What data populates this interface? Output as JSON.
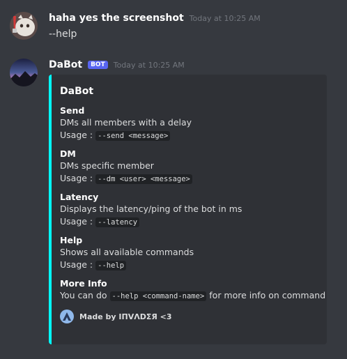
{
  "messages": [
    {
      "username": "haha yes the screenshot",
      "timestamp": "Today at 10:25 AM",
      "text": "--help"
    },
    {
      "username": "DaBot",
      "badge": "BOT",
      "timestamp": "Today at 10:25 AM"
    }
  ],
  "embed": {
    "accent_color": "#00ffff",
    "title": "DaBot",
    "fields": [
      {
        "name": "Send",
        "description": "DMs all members with a delay",
        "usage_label": "Usage :",
        "usage_code": "--send <message>"
      },
      {
        "name": "DM",
        "description": "DMs specific member",
        "usage_label": "Usage :",
        "usage_code": "--dm <user> <message>"
      },
      {
        "name": "Latency",
        "description": "Displays the latency/ping of the bot in ms",
        "usage_label": "Usage :",
        "usage_code": "--latency"
      },
      {
        "name": "Help",
        "description": "Shows all available commands",
        "usage_label": "Usage :",
        "usage_code": "--help"
      }
    ],
    "more_info": {
      "name": "More Info",
      "prefix": "You can do",
      "code": "--help <command-name>",
      "suffix": "for more info on command"
    },
    "footer": {
      "icon": "triangle-logo-icon",
      "text": "Made by IПVΛDΣЯ <3"
    }
  }
}
